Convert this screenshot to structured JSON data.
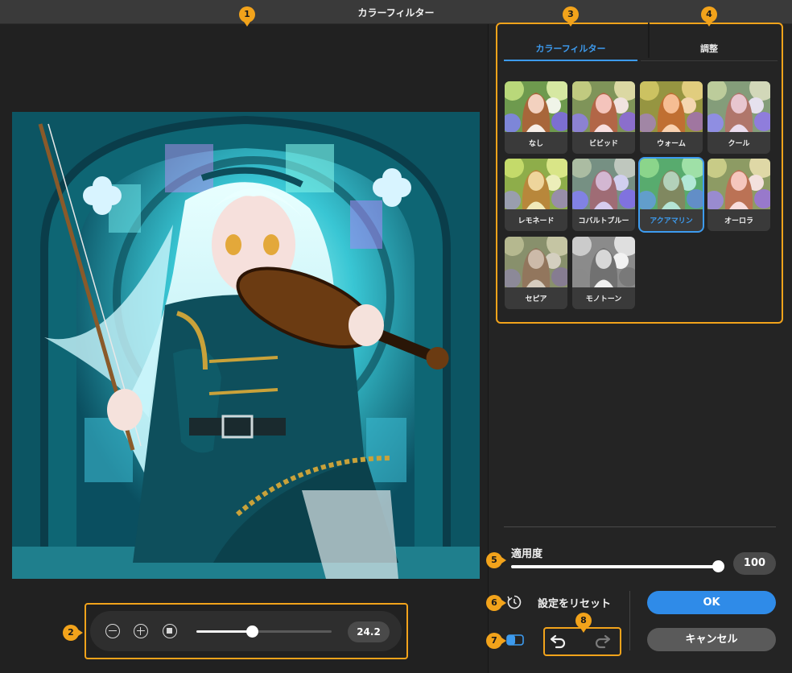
{
  "window": {
    "title": "カラーフィルター"
  },
  "tabs": [
    {
      "label": "カラーフィルター",
      "active": true
    },
    {
      "label": "調整",
      "active": false
    }
  ],
  "filters": [
    {
      "label": "なし",
      "tint": "none"
    },
    {
      "label": "ビビッド",
      "tint": "vivid"
    },
    {
      "label": "ウォーム",
      "tint": "warm"
    },
    {
      "label": "クール",
      "tint": "cool"
    },
    {
      "label": "レモネード",
      "tint": "lemonade"
    },
    {
      "label": "コバルトブルー",
      "tint": "cobalt"
    },
    {
      "label": "アクアマリン",
      "tint": "aquamarine",
      "selected": true
    },
    {
      "label": "オーロラ",
      "tint": "aurora"
    },
    {
      "label": "セピア",
      "tint": "sepia"
    },
    {
      "label": "モノトーン",
      "tint": "mono"
    }
  ],
  "zoom": {
    "value": "24.2",
    "slider_fraction": 0.41
  },
  "strength": {
    "label": "適用度",
    "value": "100",
    "fraction": 1.0
  },
  "reset": {
    "label": "設定をリセット"
  },
  "buttons": {
    "ok": "OK",
    "cancel": "キャンセル"
  },
  "colors": {
    "accent": "#3d9bef",
    "annotation": "#f2a31b",
    "ok_button": "#2f8be8"
  },
  "annotations": [
    "1",
    "2",
    "3",
    "4",
    "5",
    "6",
    "7",
    "8"
  ]
}
